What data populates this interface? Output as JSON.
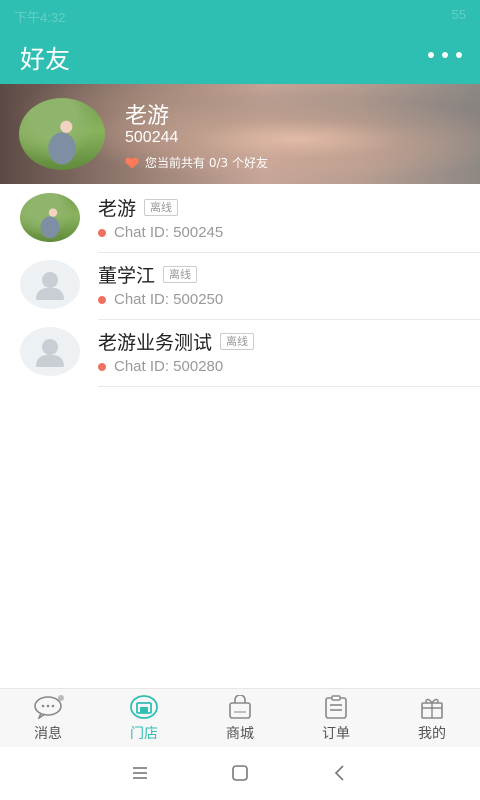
{
  "statusbar": {
    "time": "下午4:32",
    "battery": "55"
  },
  "appbar": {
    "title": "好友",
    "more_icon": "more-dots-icon"
  },
  "profile": {
    "name": "老游",
    "uid": "500244",
    "count_text": "您当前共有 0/3 个好友"
  },
  "friends": [
    {
      "name": "老游",
      "status": "离线",
      "chat_id": "Chat ID: 500245",
      "avatar": "photo"
    },
    {
      "name": "董学江",
      "status": "离线",
      "chat_id": "Chat ID: 500250",
      "avatar": "placeholder"
    },
    {
      "name": "老游业务测试",
      "status": "离线",
      "chat_id": "Chat ID: 500280",
      "avatar": "placeholder"
    }
  ],
  "tabs": [
    {
      "label": "消息",
      "icon": "chat-bubble-icon"
    },
    {
      "label": "门店",
      "icon": "store-icon",
      "active": true
    },
    {
      "label": "商城",
      "icon": "shopping-bag-icon"
    },
    {
      "label": "订单",
      "icon": "clipboard-icon"
    },
    {
      "label": "我的",
      "icon": "gift-icon"
    }
  ],
  "colors": {
    "accent": "#2fbfb2",
    "offline_dot": "#f07060"
  }
}
